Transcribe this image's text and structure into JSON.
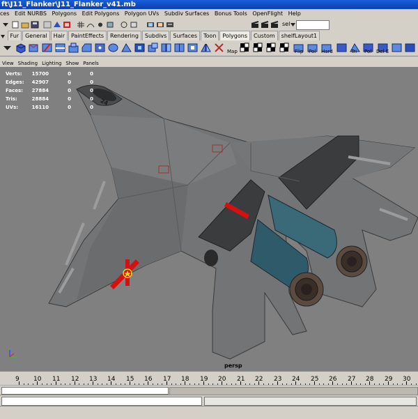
{
  "window": {
    "title": "ft\\J11_Flanker\\J11_Flanker_v41.mb"
  },
  "menu": [
    "ces",
    "Edit NURBS",
    "Polygons",
    "Edit Polygons",
    "Polygon UVs",
    "Subdiv Surfaces",
    "Bonus Tools",
    "OpenFlight",
    "Help"
  ],
  "status_line": {
    "selection_label": "sel",
    "selection_input": ""
  },
  "shelf_tabs": [
    {
      "label": "Fur",
      "active": false
    },
    {
      "label": "General",
      "active": false
    },
    {
      "label": "Hair",
      "active": false
    },
    {
      "label": "PaintEffects",
      "active": false
    },
    {
      "label": "Rendering",
      "active": false
    },
    {
      "label": "Subdivs",
      "active": false
    },
    {
      "label": "Surfaces",
      "active": false
    },
    {
      "label": "Toon",
      "active": false
    },
    {
      "label": "Polygons",
      "active": true
    },
    {
      "label": "Custom",
      "active": false
    },
    {
      "label": "shelfLayout1",
      "active": false
    }
  ],
  "shelf_labels": [
    "Map",
    "Flip",
    "Pol",
    "Hard",
    "Tri",
    "Pol",
    "Del E"
  ],
  "panel_menu": [
    "View",
    "Shading",
    "Lighting",
    "Show",
    "Panels"
  ],
  "hud": [
    {
      "label": "Verts:",
      "v1": "15700",
      "v2": "0",
      "v3": "0"
    },
    {
      "label": "Edges:",
      "v1": "42907",
      "v2": "0",
      "v3": "0"
    },
    {
      "label": "Faces:",
      "v1": "27884",
      "v2": "0",
      "v3": "0"
    },
    {
      "label": "Tris:",
      "v1": "28884",
      "v2": "0",
      "v3": "0"
    },
    {
      "label": "UVs:",
      "v1": "16110",
      "v2": "0",
      "v3": "0"
    }
  ],
  "aircraft_markings": {
    "tail_number": "24"
  },
  "camera_label": "persp",
  "timeline": {
    "ticks": [
      "9",
      "10",
      "11",
      "12",
      "13",
      "14",
      "15",
      "16",
      "17",
      "18",
      "19",
      "20",
      "21",
      "22",
      "23",
      "24",
      "25",
      "26",
      "27",
      "28",
      "29",
      "30"
    ]
  },
  "colors": {
    "viewport_bg": "#808080",
    "ui_bg": "#d4d0c8",
    "title_bar": "#1a5fd8",
    "aircraft_body": "#6e7070",
    "aircraft_dark": "#3e4042",
    "insignia_red": "#d41010",
    "insignia_yellow": "#f0d020",
    "engine_teal": "#2f5a6a"
  }
}
